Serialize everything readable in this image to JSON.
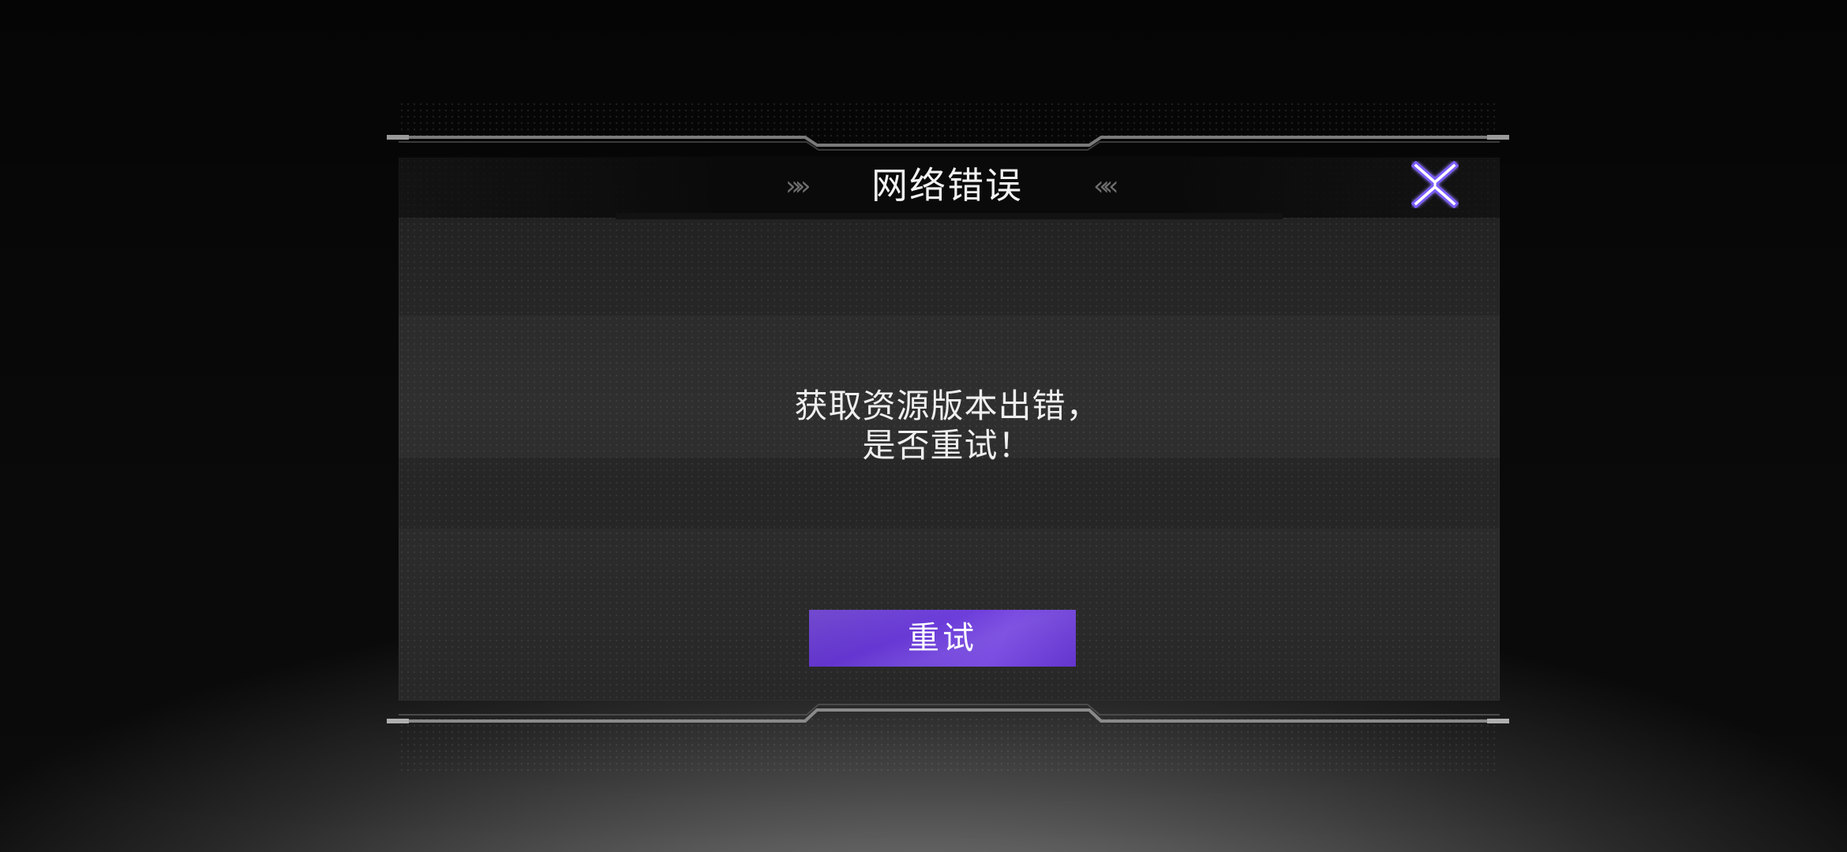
{
  "dialog": {
    "title": "网络错误",
    "title_chevron_left": "»»",
    "title_chevron_right": "««",
    "message_line1": "获取资源版本出错，",
    "message_line2": "是否重试！",
    "retry_label": "重试",
    "close_icon": "close-x-icon"
  },
  "colors": {
    "accent_purple": "#6a3bd8",
    "close_icon_glow": "#7c5cff",
    "panel_bg": "#252525",
    "title_bar_bg": "#0a0a0a",
    "text": "#f2f2f2"
  }
}
